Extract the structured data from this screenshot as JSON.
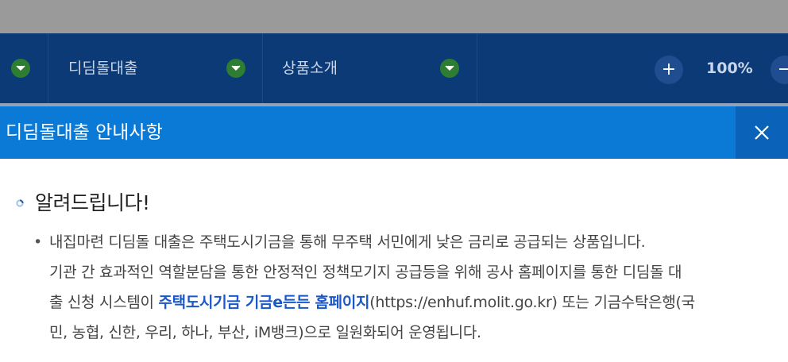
{
  "nav": {
    "item1_label": "디딤돌대출",
    "item2_label": "상품소개",
    "zoom_in": "+",
    "zoom_level": "100%",
    "zoom_out": "−"
  },
  "modal": {
    "title": "디딤돌대출 안내사항",
    "close_icon": "close-icon"
  },
  "notice": {
    "heading": "알려드립니다!",
    "line1": "내집마련 디딤돌 대출은 주택도시기금을 통해 무주택 서민에게 낮은 금리로 공급되는 상품입니다.",
    "line2": "기관 간 효과적인 역할분담을 통한 안정적인 정책모기지 공급등을 위해 공사 홈페이지를 통한 디딤돌 대",
    "line3_pre": "출 신청 시스템이 ",
    "line3_link": "주택도시기금 기금e든든 홈페이지",
    "line3_post": "(https://enhuf.molit.go.kr) 또는 기금수탁은행(국",
    "line4": "민, 농협, 신한, 우리, 하나, 부산, iM뱅크)으로 일원화되어 운영됩니다."
  },
  "colors": {
    "nav_bg": "#0b3a76",
    "modal_header": "#0a7ad6",
    "link": "#1a57c7",
    "dropdown_green": "#2e7d32"
  }
}
